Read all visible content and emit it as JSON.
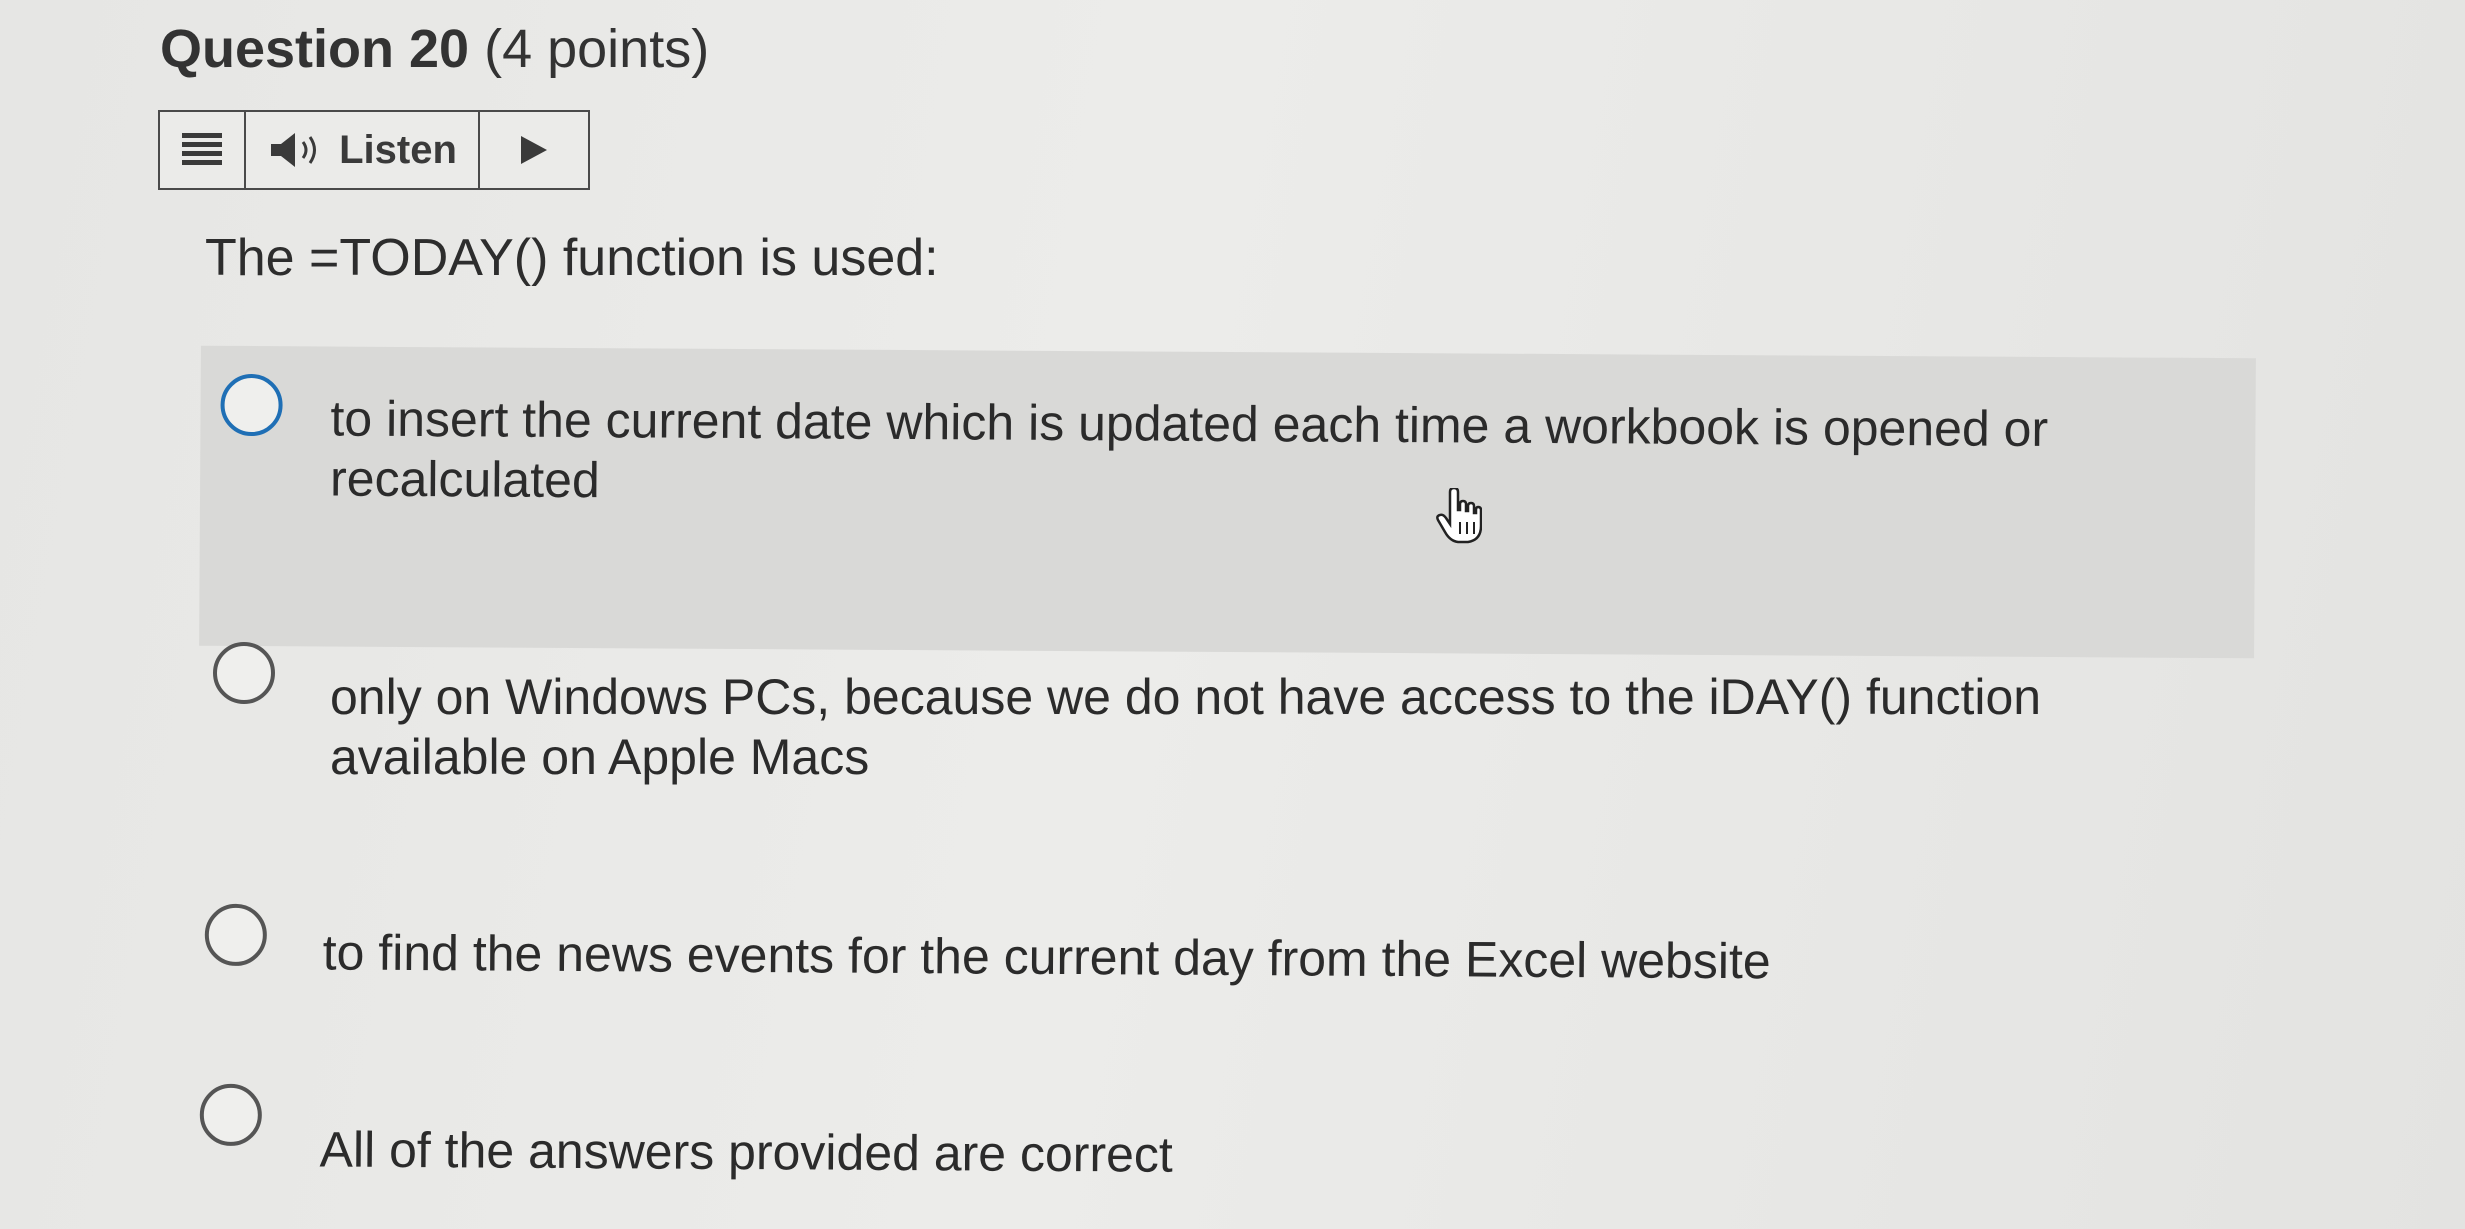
{
  "question": {
    "title": "Question 20",
    "points": "(4 points)"
  },
  "listen_bar": {
    "menu_icon": "menu-lines-icon",
    "speaker_icon": "speaker-icon",
    "listen_label": "Listen",
    "play_icon": "play-triangle-icon"
  },
  "prompt": "The =TODAY() function is used:",
  "options": [
    {
      "label": "to insert the current date which is updated each time a workbook is opened or recalculated"
    },
    {
      "label": "only on Windows PCs, because we do not have access to the iDAY() function available on Apple Macs"
    },
    {
      "label": "to find the news events for the current day from the Excel website"
    },
    {
      "label": "All of the answers provided are correct"
    }
  ],
  "colors": {
    "focus_ring": "#1f6fb5",
    "hover_background": "#d9d9d7"
  }
}
